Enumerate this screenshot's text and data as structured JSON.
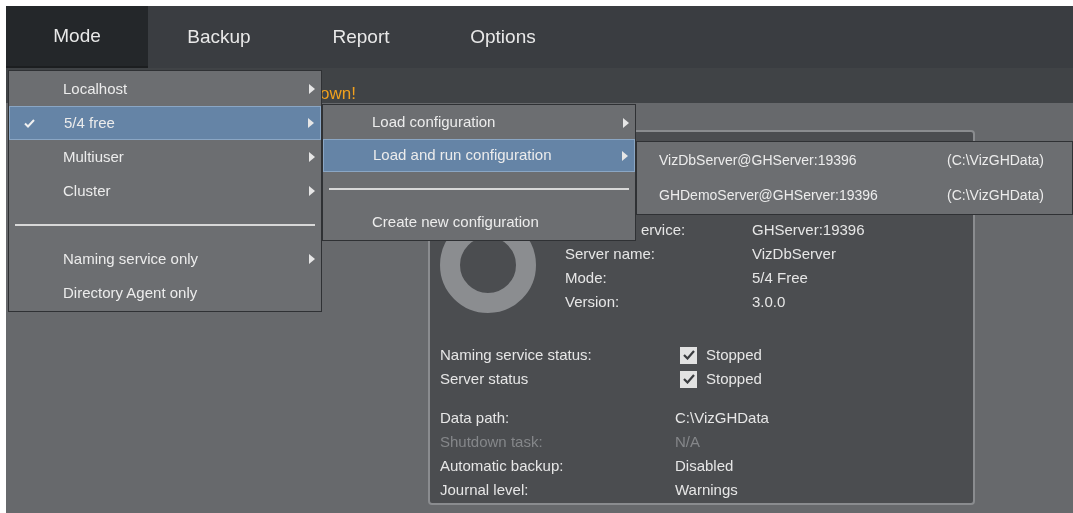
{
  "menu_bar": [
    {
      "label": "Mode",
      "selected": true
    },
    {
      "label": "Backup",
      "selected": false
    },
    {
      "label": "Report",
      "selected": false
    },
    {
      "label": "Options",
      "selected": false
    }
  ],
  "toolbar": {
    "notice": "own!"
  },
  "mode_menu": {
    "items": [
      {
        "kind": "item",
        "label": "Localhost",
        "checked": false,
        "selected": false,
        "has_submenu": true
      },
      {
        "kind": "item",
        "label": "5/4 free",
        "checked": true,
        "selected": true,
        "has_submenu": true
      },
      {
        "kind": "item",
        "label": "Multiuser",
        "checked": false,
        "selected": false,
        "has_submenu": true
      },
      {
        "kind": "item",
        "label": "Cluster",
        "checked": false,
        "selected": false,
        "has_submenu": true
      },
      {
        "kind": "separator"
      },
      {
        "kind": "item",
        "label": "Naming service only",
        "checked": false,
        "selected": false,
        "has_submenu": true
      },
      {
        "kind": "item",
        "label": "Directory Agent only",
        "checked": false,
        "selected": false,
        "has_submenu": false
      }
    ]
  },
  "configuration_menu": {
    "items": [
      {
        "kind": "item",
        "label": "Load configuration",
        "selected": false,
        "has_submenu": true
      },
      {
        "kind": "item",
        "label": "Load and run configuration",
        "selected": true,
        "has_submenu": true
      },
      {
        "kind": "separator"
      },
      {
        "kind": "item",
        "label": "Create new configuration",
        "selected": false,
        "has_submenu": false
      }
    ]
  },
  "configurations_menu": {
    "items": [
      {
        "name": "VizDbServer@GHServer:19396",
        "path": "(C:\\VizGHData)",
        "selected": false
      },
      {
        "name": "GHDemoServer@GHServer:19396",
        "path": "(C:\\VizGHData)",
        "selected": false
      }
    ]
  },
  "server_panel": {
    "info": [
      {
        "label": "ervice:",
        "value": "GHServer:19396"
      },
      {
        "label": "Server name:",
        "value": "VizDbServer"
      },
      {
        "label": "Mode:",
        "value": "5/4 Free"
      },
      {
        "label": "Version:",
        "value": "3.0.0"
      }
    ],
    "statuses": [
      {
        "label": "Naming service status:",
        "checked": true,
        "value": "Stopped"
      },
      {
        "label": "Server status",
        "checked": true,
        "value": "Stopped"
      }
    ],
    "details": [
      {
        "label": "Data path:",
        "value": "C:\\VizGHData",
        "disabled": false
      },
      {
        "label": "Shutdown task:",
        "value": "N/A",
        "disabled": true
      },
      {
        "label": "Automatic backup:",
        "value": "Disabled",
        "disabled": false
      },
      {
        "label": "Journal level:",
        "value": "Warnings",
        "disabled": false
      }
    ]
  }
}
